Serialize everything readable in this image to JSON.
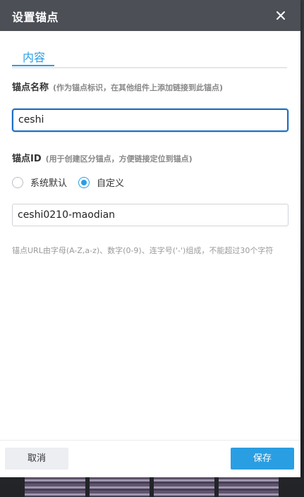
{
  "dialog": {
    "title": "设置锚点",
    "close_icon": "close-icon"
  },
  "tabs": [
    {
      "label": "内容",
      "active": true
    }
  ],
  "anchor_name": {
    "label": "锚点名称",
    "hint": "(作为锚点标识，在其他组件上添加链接到此锚点)",
    "value": "ceshi"
  },
  "anchor_id": {
    "label": "锚点ID",
    "hint": "(用于创建区分锚点，方便链接定位到锚点)",
    "options": [
      {
        "label": "系统默认",
        "checked": false
      },
      {
        "label": "自定义",
        "checked": true
      }
    ],
    "value": "ceshi0210-maodian"
  },
  "note": "锚点URL由字母(A-Z,a-z)、数字(0-9)、连字号('-')组成，不能超过30个字符",
  "footer": {
    "cancel_label": "取消",
    "save_label": "保存"
  },
  "colors": {
    "accent": "#2a9ee2",
    "header_bg": "#4c5056",
    "focus_border": "#1e6fc4"
  }
}
